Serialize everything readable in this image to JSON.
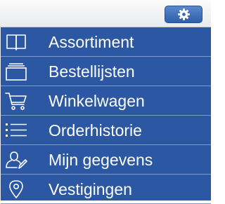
{
  "header": {
    "settings_icon": "gear-icon"
  },
  "menu": {
    "items": [
      {
        "label": "Assortiment",
        "icon": "book-icon"
      },
      {
        "label": "Bestellijsten",
        "icon": "tray-stack-icon"
      },
      {
        "label": "Winkelwagen",
        "icon": "cart-icon"
      },
      {
        "label": "Orderhistorie",
        "icon": "list-icon"
      },
      {
        "label": "Mijn gegevens",
        "icon": "user-edit-icon"
      },
      {
        "label": "Vestigingen",
        "icon": "location-pin-icon"
      }
    ]
  },
  "colors": {
    "menu_background": "#2b57a3",
    "divider": "#7d9ccc",
    "text": "#ffffff",
    "button": "#3f6fb8"
  }
}
